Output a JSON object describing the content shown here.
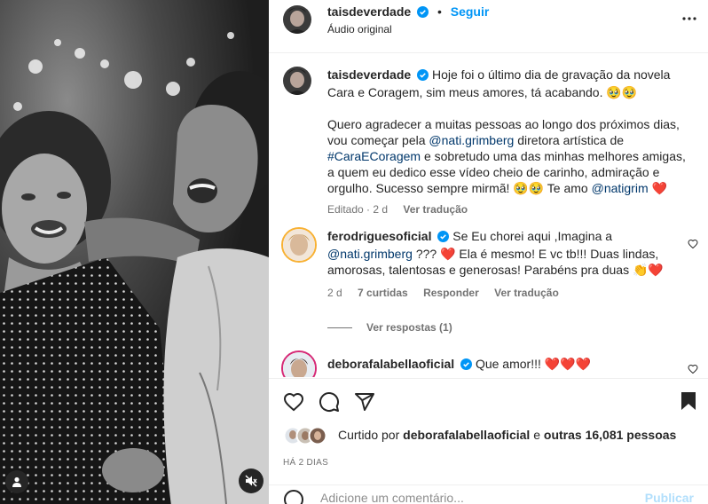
{
  "post": {
    "author": "taisdeverdade",
    "follow_label": "Seguir",
    "audio": "Áudio original"
  },
  "caption": {
    "author": "taisdeverdade",
    "text_1": "Hoje foi o último dia de gravação da novela Cara e Coragem, sim meus amores, tá acabando. 🥹🥹",
    "text_2a": "Quero agradecer a muitas pessoas ao longo dos próximos dias, vou começar pela",
    "mention_1": "@nati.grimberg",
    "text_2b": "diretora artística de",
    "hashtag": "#CaraECoragem",
    "text_2c": "e sobretudo uma das minhas melhores amigas, a quem eu dedico esse vídeo cheio de carinho, admiração e orgulho. Sucesso sempre mirmã! 🥹🥹 Te amo",
    "mention_2": "@natigrim",
    "meta_edited": "Editado · 2 d",
    "meta_translate": "Ver tradução"
  },
  "comments": [
    {
      "user": "ferodriguesoficial",
      "text_a": "Se Eu chorei aqui ,Imagina a",
      "mention": "@nati.grimberg",
      "text_b": "??? ❤️ Ela é mesmo! E vc tb!!! Duas lindas, amorosas, talentosas e generosas! Parabéns pra duas 👏❤️",
      "time": "2 d",
      "likes": "7 curtidas",
      "reply": "Responder",
      "translate": "Ver tradução",
      "view_replies": "Ver respostas (1)"
    },
    {
      "user": "deborafalabellaoficial",
      "text": "Que amor!!! ❤️❤️❤️"
    }
  ],
  "likes": {
    "prefix": "Curtido por",
    "user": "deborafalabellaoficial",
    "middle": "e",
    "others": "outras 16,081 pessoas"
  },
  "timestamp": "HÁ 2 DIAS",
  "add_comment": {
    "placeholder": "Adicione um comentário...",
    "publish": "Publicar"
  },
  "colors": {
    "link": "#00376b",
    "follow": "#0095f6",
    "verified": "#0095f6",
    "heart": "#ed4956"
  }
}
